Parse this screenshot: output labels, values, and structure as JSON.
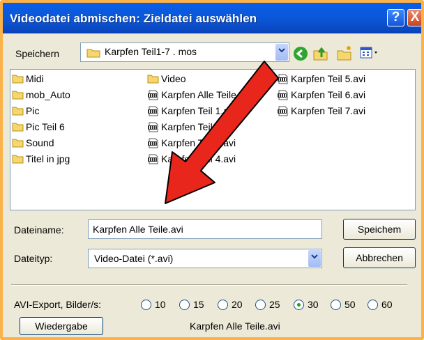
{
  "window": {
    "title": "Videodatei abmischen: Zieldatei auswählen",
    "help_glyph": "?",
    "close_glyph": "X"
  },
  "save_in": {
    "label": "Speichern",
    "folder": "Karpfen Teil1-7 . mos"
  },
  "files": {
    "col1": [
      {
        "name": "Midi",
        "icon": "folder-icon"
      },
      {
        "name": "mob_Auto",
        "icon": "folder-icon"
      },
      {
        "name": "Pic",
        "icon": "folder-icon"
      },
      {
        "name": "Pic Teil 6",
        "icon": "folder-icon"
      },
      {
        "name": "Sound",
        "icon": "folder-icon"
      },
      {
        "name": "Titel in jpg",
        "icon": "folder-icon"
      }
    ],
    "col2": [
      {
        "name": "Video",
        "icon": "folder-icon"
      },
      {
        "name": "Karpfen Alle Teile.avi",
        "icon": "avi-file-icon"
      },
      {
        "name": "Karpfen Teil 1.avi",
        "icon": "avi-file-icon"
      },
      {
        "name": "Karpfen Teil 2.avi",
        "icon": "avi-file-icon"
      },
      {
        "name": "Karpfen Teil 3.avi",
        "icon": "avi-file-icon"
      },
      {
        "name": "Karpfen Teil 4.avi",
        "icon": "avi-file-icon"
      }
    ],
    "col3": [
      {
        "name": "Karpfen Teil 5.avi",
        "icon": "avi-file-icon"
      },
      {
        "name": "Karpfen Teil 6.avi",
        "icon": "avi-file-icon"
      },
      {
        "name": "Karpfen Teil 7.avi",
        "icon": "avi-file-icon"
      }
    ]
  },
  "filename": {
    "label": "Dateiname:",
    "value": "Karpfen Alle Teile.avi"
  },
  "filetype": {
    "label": "Dateityp:",
    "value": "Video-Datei (*.avi)"
  },
  "buttons": {
    "save": "Speichem",
    "cancel": "Abbrechen",
    "playback": "Wiedergabe"
  },
  "avi_export": {
    "label": "AVI-Export, Bilder/s:",
    "options": [
      "10",
      "15",
      "20",
      "25",
      "30",
      "50",
      "60"
    ],
    "selected": "30"
  },
  "playback_file": "Karpfen Alle Teile.avi",
  "annotation": {
    "arrow_color": "#e8261c"
  }
}
